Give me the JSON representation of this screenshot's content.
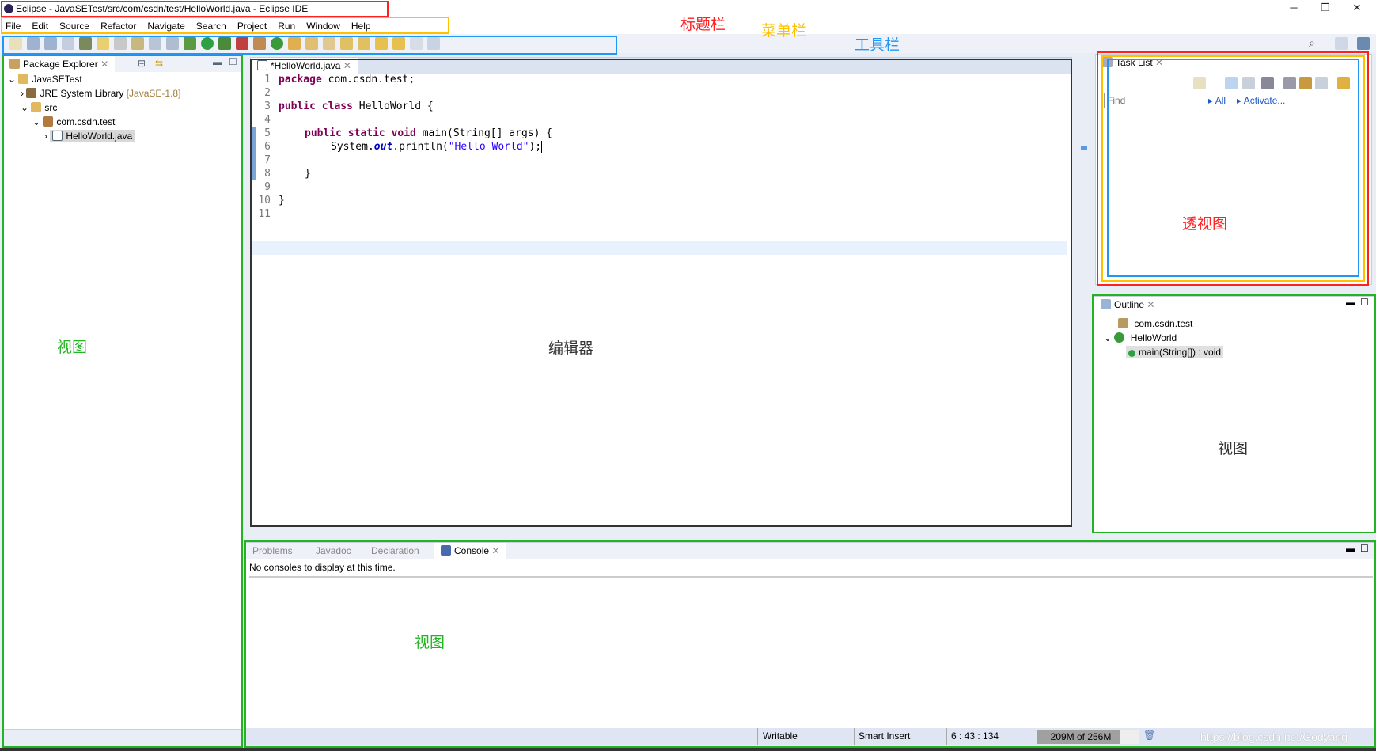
{
  "window": {
    "title": "Eclipse - JavaSETest/src/com/csdn/test/HelloWorld.java - Eclipse IDE",
    "minimize": "─",
    "restore": "❐",
    "close": "✕"
  },
  "menu": [
    "File",
    "Edit",
    "Source",
    "Refactor",
    "Navigate",
    "Search",
    "Project",
    "Run",
    "Window",
    "Help"
  ],
  "package_explorer": {
    "title": "Package Explorer",
    "tree": [
      {
        "label": "JavaSETest",
        "extra": ""
      },
      {
        "label": "JRE System Library",
        "extra": "[JavaSE-1.8]"
      },
      {
        "label": "src",
        "extra": ""
      },
      {
        "label": "com.csdn.test",
        "extra": ""
      },
      {
        "label": "HelloWorld.java",
        "extra": ""
      }
    ]
  },
  "editor": {
    "tab": "*HelloWorld.java",
    "line_numbers": [
      "1",
      "2",
      "3",
      "4",
      "5",
      "6",
      "7",
      "8",
      "9",
      "10",
      "11"
    ],
    "code": {
      "l1kw": "package",
      "l1": " com.csdn.test;",
      "l3kw": "public class",
      "l3": " HelloWorld {",
      "l5kw": "public static void",
      "l5": " main(String[] args) {",
      "l6a": "System.",
      "l6b": "out",
      "l6c": ".println(",
      "l6s": "\"Hello World\"",
      "l6d": ");",
      "l8": "}",
      "l10": "}"
    }
  },
  "task_list": {
    "title": "Task List",
    "find_placeholder": "Find",
    "all": "All",
    "activate": "Activate..."
  },
  "outline": {
    "title": "Outline",
    "items": [
      "com.csdn.test",
      "HelloWorld",
      "main(String[]) : void"
    ]
  },
  "console": {
    "tabs": [
      "Problems",
      "Javadoc",
      "Declaration",
      "Console"
    ],
    "message": "No consoles to display at this time."
  },
  "status": {
    "writable": "Writable",
    "insert_mode": "Smart Insert",
    "position": "6 : 43 : 134",
    "heap": "209M of 256M",
    "heap_used_fraction": 0.816
  },
  "annotations": {
    "title_bar": "标题栏",
    "menu_bar": "菜单栏",
    "toolbar": "工具栏",
    "perspective": "透视图",
    "view_left": "视图",
    "editor": "编辑器",
    "view_right": "视图",
    "view_bottom": "视图"
  },
  "watermark": "https://blog.csdn.net/Godyang",
  "colors": {
    "keyword": "#7f0055",
    "string": "#2a00ff",
    "field": "#0000c0",
    "annot_red": "#ff2020",
    "annot_orange": "#ffc000",
    "annot_blue": "#2196f3",
    "annot_green": "#22b422"
  }
}
